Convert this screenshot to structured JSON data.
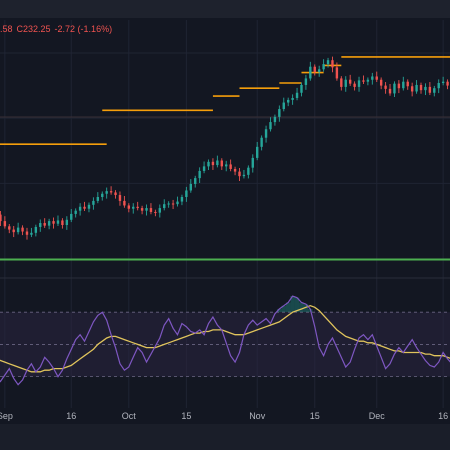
{
  "header": {
    "ohlc_fragment": ".58",
    "close_value": "C232.25",
    "change": "-2.72 (-1.16%)"
  },
  "colors": {
    "background": "#131722",
    "up": "#26a69a",
    "down": "#ef5350",
    "level_line": "#f59e0b",
    "support_line": "#4caf50",
    "rsi_line": "#7e57c2",
    "rsi_ma_line": "#e0c45c",
    "rsi_band": "#2a2440",
    "grid": "#1f2433",
    "axis_text": "#b2b5be"
  },
  "chart_data": [
    {
      "type": "candlestick",
      "series": [
        {
          "name": "",
          "x": [
            0,
            1,
            2,
            3,
            4,
            5,
            6,
            7,
            8,
            9,
            10,
            11,
            12,
            13,
            14,
            15,
            16,
            17,
            18,
            19,
            20,
            21,
            22,
            23,
            24,
            25,
            26,
            27,
            28,
            29,
            30,
            31,
            32,
            33,
            34,
            35,
            36,
            37,
            38,
            39,
            40,
            41,
            42,
            43,
            44,
            45,
            46,
            47,
            48,
            49,
            50,
            51,
            52,
            53,
            54,
            55,
            56,
            57,
            58,
            59,
            60,
            61,
            62,
            63,
            64,
            65,
            66,
            67,
            68,
            69,
            70,
            71,
            72,
            73,
            74,
            75,
            76,
            77,
            78,
            79,
            80,
            81,
            82,
            83,
            84,
            85,
            86,
            87,
            88,
            89,
            90,
            91,
            92,
            93,
            94,
            95,
            96,
            97,
            98,
            99,
            100,
            101,
            102,
            103
          ],
          "close": [
            215.2,
            214.2,
            213.4,
            212.9,
            212.5,
            213.2,
            212.6,
            212.1,
            212.4,
            213.3,
            213.9,
            213.5,
            214.2,
            213.8,
            214.3,
            213.6,
            214.4,
            215.3,
            215.8,
            216.4,
            216.1,
            216.7,
            217.3,
            217.9,
            218.4,
            218.8,
            218.6,
            218.2,
            217.3,
            216.6,
            216.1,
            216.4,
            216.2,
            215.8,
            216.2,
            215.6,
            215.5,
            216.2,
            216.8,
            216.9,
            216.8,
            217.2,
            217.9,
            218.9,
            219.9,
            220.8,
            221.9,
            222.6,
            223.3,
            222.8,
            223.5,
            222.6,
            222.9,
            222.2,
            221.8,
            221.1,
            221.3,
            222.4,
            223.9,
            225.6,
            227.0,
            228.3,
            229.4,
            230.2,
            231.4,
            232.4,
            232.8,
            233.1,
            233.9,
            235.1,
            236.1,
            237.9,
            237.1,
            237.5,
            238.3,
            238.9,
            237.8,
            236.1,
            234.8,
            235.9,
            235.3,
            234.8,
            235.8,
            235.6,
            235.9,
            236.4,
            235.9,
            235.0,
            234.5,
            233.8,
            235.3,
            234.6,
            235.6,
            234.9,
            234.1,
            235.1,
            234.3,
            234.8,
            233.9,
            234.6,
            235.4,
            235.6,
            235.0,
            234.2
          ],
          "open": [
            215.6,
            215.2,
            214.2,
            213.4,
            212.9,
            212.5,
            213.2,
            212.6,
            212.1,
            212.4,
            213.3,
            213.9,
            213.5,
            214.2,
            213.8,
            214.3,
            213.6,
            214.4,
            215.3,
            215.8,
            216.4,
            216.1,
            216.7,
            217.3,
            217.9,
            218.4,
            218.8,
            218.6,
            218.2,
            217.3,
            216.6,
            216.1,
            216.4,
            216.2,
            215.8,
            216.2,
            215.6,
            215.5,
            216.2,
            216.8,
            216.9,
            216.8,
            217.2,
            217.9,
            218.9,
            219.9,
            220.8,
            221.9,
            222.6,
            223.3,
            222.8,
            223.5,
            222.6,
            222.9,
            222.2,
            221.8,
            221.1,
            221.3,
            222.4,
            223.9,
            225.6,
            227.0,
            228.3,
            229.4,
            230.2,
            231.4,
            232.4,
            232.8,
            233.1,
            233.9,
            235.1,
            236.1,
            237.9,
            237.1,
            237.5,
            238.3,
            238.9,
            237.8,
            236.1,
            234.8,
            235.9,
            235.3,
            234.8,
            235.8,
            235.6,
            235.9,
            236.4,
            235.9,
            235.0,
            234.5,
            233.8,
            235.3,
            234.6,
            235.6,
            234.9,
            234.1,
            235.1,
            234.3,
            234.8,
            233.9,
            234.6,
            235.4,
            235.6,
            235.0
          ]
        }
      ],
      "levels": [
        {
          "y": 226.0,
          "x_start": 0,
          "x_end": 25,
          "color": "level_line"
        },
        {
          "y": 231.2,
          "x_start": 24,
          "x_end": 49,
          "color": "level_line"
        },
        {
          "y": 233.4,
          "x_start": 49,
          "x_end": 55,
          "color": "level_line"
        },
        {
          "y": 234.6,
          "x_start": 55,
          "x_end": 64,
          "color": "level_line"
        },
        {
          "y": 235.4,
          "x_start": 64,
          "x_end": 69,
          "color": "level_line"
        },
        {
          "y": 237.0,
          "x_start": 69,
          "x_end": 74,
          "color": "level_line"
        },
        {
          "y": 238.1,
          "x_start": 74,
          "x_end": 78,
          "color": "level_line"
        },
        {
          "y": 239.4,
          "x_start": 78,
          "x_end": 103,
          "color": "level_line"
        },
        {
          "y": 208.3,
          "x_start": 0,
          "x_end": 103,
          "color": "support_line"
        }
      ],
      "xticks": [
        {
          "label": "Sep",
          "x": 2
        },
        {
          "label": "16",
          "x": 17
        },
        {
          "label": "Oct",
          "x": 30
        },
        {
          "label": "15",
          "x": 43
        },
        {
          "label": "Nov",
          "x": 59
        },
        {
          "label": "15",
          "x": 72
        },
        {
          "label": "Dec",
          "x": 86
        },
        {
          "label": "16",
          "x": 101
        }
      ],
      "ylim": [
        207.0,
        242.0
      ],
      "xlim": [
        0,
        103
      ]
    },
    {
      "type": "line",
      "series": [
        {
          "name": "",
          "color": "rsi_line",
          "x": [
            0,
            1,
            2,
            3,
            4,
            5,
            6,
            7,
            8,
            9,
            10,
            11,
            12,
            13,
            14,
            15,
            16,
            17,
            18,
            19,
            20,
            21,
            22,
            23,
            24,
            25,
            26,
            27,
            28,
            29,
            30,
            31,
            32,
            33,
            34,
            35,
            36,
            37,
            38,
            39,
            40,
            41,
            42,
            43,
            44,
            45,
            46,
            47,
            48,
            49,
            50,
            51,
            52,
            53,
            54,
            55,
            56,
            57,
            58,
            59,
            60,
            61,
            62,
            63,
            64,
            65,
            66,
            67,
            68,
            69,
            70,
            71,
            72,
            73,
            74,
            75,
            76,
            77,
            78,
            79,
            80,
            81,
            82,
            83,
            84,
            85,
            86,
            87,
            88,
            89,
            90,
            91,
            92,
            93,
            94,
            95,
            96,
            97,
            98,
            99,
            100,
            101,
            102,
            103
          ],
          "values": [
            30,
            27,
            31,
            35,
            29,
            25,
            28,
            34,
            38,
            33,
            36,
            42,
            39,
            35,
            30,
            34,
            41,
            47,
            53,
            56,
            52,
            58,
            64,
            68,
            70,
            65,
            56,
            48,
            38,
            34,
            36,
            42,
            48,
            45,
            39,
            44,
            49,
            54,
            62,
            66,
            60,
            56,
            63,
            61,
            58,
            57,
            59,
            56,
            63,
            67,
            62,
            59,
            51,
            43,
            39,
            45,
            56,
            62,
            65,
            62,
            64,
            66,
            63,
            69,
            72,
            74,
            76,
            80,
            79,
            76,
            75,
            72,
            61,
            48,
            43,
            50,
            54,
            48,
            42,
            36,
            39,
            47,
            54,
            56,
            53,
            56,
            49,
            42,
            35,
            38,
            44,
            48,
            45,
            49,
            53,
            48,
            44,
            40,
            37,
            36,
            39,
            45,
            41,
            38
          ]
        },
        {
          "name": "",
          "color": "rsi_ma_line",
          "x": [
            0,
            1,
            2,
            3,
            4,
            5,
            6,
            7,
            8,
            9,
            10,
            11,
            12,
            13,
            14,
            15,
            16,
            17,
            18,
            19,
            20,
            21,
            22,
            23,
            24,
            25,
            26,
            27,
            28,
            29,
            30,
            31,
            32,
            33,
            34,
            35,
            36,
            37,
            38,
            39,
            40,
            41,
            42,
            43,
            44,
            45,
            46,
            47,
            48,
            49,
            50,
            51,
            52,
            53,
            54,
            55,
            56,
            57,
            58,
            59,
            60,
            61,
            62,
            63,
            64,
            65,
            66,
            67,
            68,
            69,
            70,
            71,
            72,
            73,
            74,
            75,
            76,
            77,
            78,
            79,
            80,
            81,
            82,
            83,
            84,
            85,
            86,
            87,
            88,
            89,
            90,
            91,
            92,
            93,
            94,
            95,
            96,
            97,
            98,
            99,
            100,
            101,
            102,
            103
          ],
          "values": [
            41,
            40,
            39,
            38,
            37,
            36,
            35,
            34,
            33,
            33,
            33,
            34,
            34,
            35,
            35,
            35,
            36,
            37,
            39,
            41,
            43,
            45,
            47,
            50,
            52,
            54,
            55,
            55,
            54,
            53,
            52,
            51,
            50,
            49,
            48,
            48,
            48,
            49,
            50,
            51,
            52,
            53,
            54,
            55,
            56,
            57,
            57,
            58,
            58,
            59,
            59,
            59,
            58,
            57,
            56,
            56,
            56,
            57,
            58,
            59,
            60,
            61,
            62,
            63,
            64,
            66,
            68,
            70,
            71,
            72,
            73,
            74,
            73,
            71,
            68,
            65,
            62,
            59,
            57,
            55,
            54,
            53,
            52,
            52,
            51,
            51,
            50,
            49,
            48,
            47,
            46,
            46,
            45,
            45,
            45,
            45,
            45,
            44,
            44,
            43,
            43,
            43,
            42,
            41
          ]
        }
      ],
      "bands": {
        "upper": 70,
        "middle": 50,
        "lower": 30
      },
      "ylim": [
        18,
        85
      ],
      "xlim": [
        0,
        103
      ]
    }
  ]
}
